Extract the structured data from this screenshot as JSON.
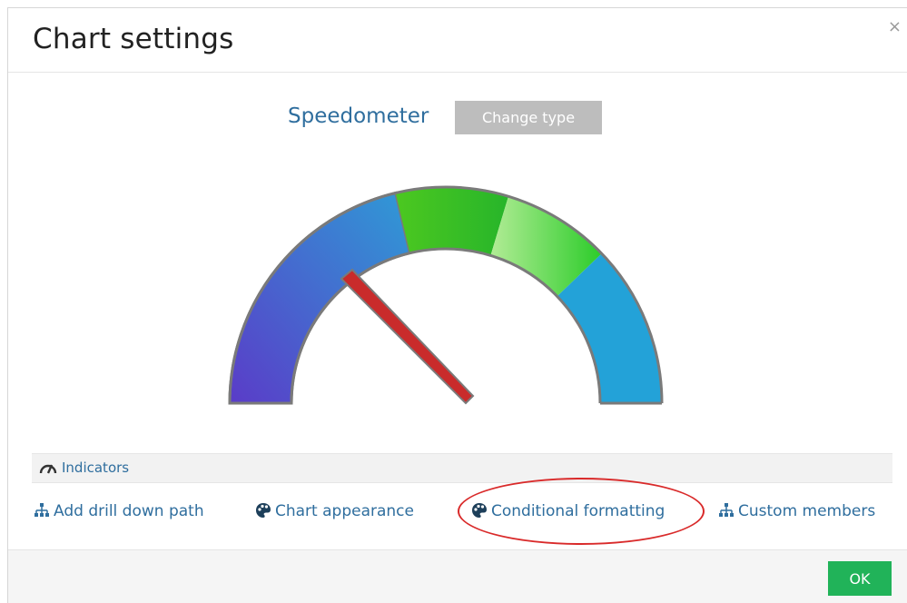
{
  "dialog": {
    "title": "Chart settings",
    "close_label": "×"
  },
  "chart": {
    "type_name": "Speedometer",
    "change_type_label": "Change type",
    "gauge": {
      "bands": [
        {
          "color_start": "#5a3cc8",
          "color_end": "#2f9ad6"
        },
        {
          "color_start": "#4cc820",
          "color_end": "#2fbd2a"
        },
        {
          "color_start": "#a8e88a",
          "color_end": "#2ccc2a"
        },
        {
          "color_start": "#23a2d8",
          "color_end": "#23a2d8"
        }
      ],
      "needle_color": "#c92b2b"
    }
  },
  "indicators": {
    "label": "Indicators",
    "icon": "gauge-icon"
  },
  "links": [
    {
      "id": "add-drill-down-path",
      "label": "Add drill down path",
      "icon": "hierarchy-icon"
    },
    {
      "id": "chart-appearance",
      "label": "Chart appearance",
      "icon": "palette-icon"
    },
    {
      "id": "conditional-formatting",
      "label": "Conditional formatting",
      "icon": "palette-icon"
    },
    {
      "id": "custom-members",
      "label": "Custom members",
      "icon": "hierarchy-icon"
    }
  ],
  "footer": {
    "ok_label": "OK"
  },
  "colors": {
    "accent_text": "#2f6e9e",
    "ok_button": "#21b359",
    "highlight": "#d92a2a"
  }
}
